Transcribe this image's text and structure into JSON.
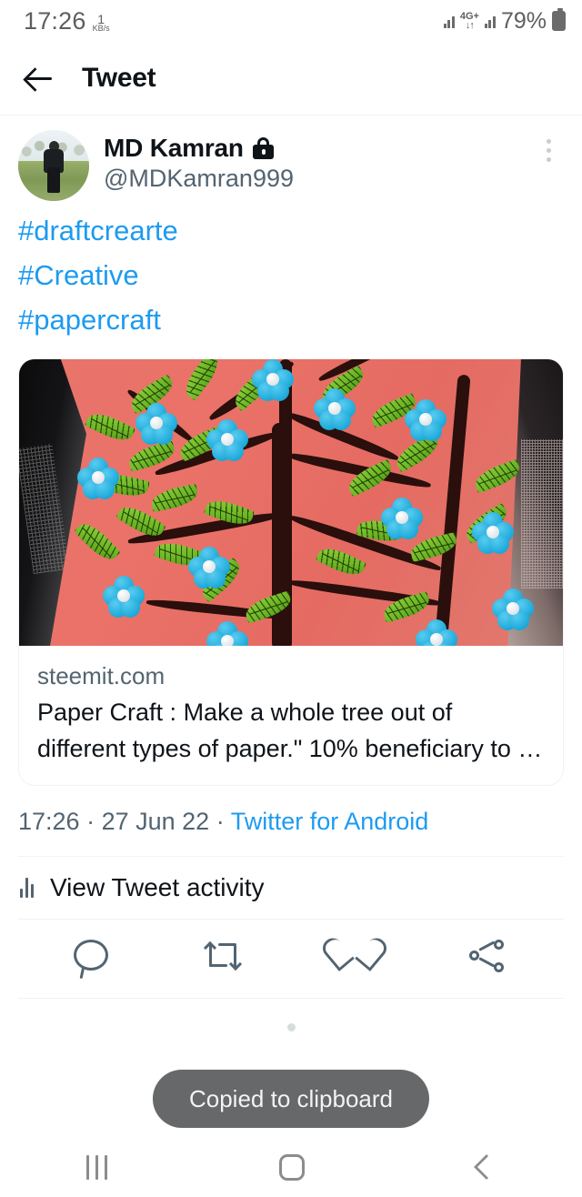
{
  "status_bar": {
    "time": "17:26",
    "network_speed_value": "1",
    "network_speed_unit": "KB/s",
    "network_type": "4G+",
    "network_arrows": "↓↑",
    "battery_percent": "79%"
  },
  "app_bar": {
    "back_icon": "arrow-left-icon",
    "title": "Tweet"
  },
  "tweet": {
    "author": {
      "display_name": "MD Kamran",
      "protected_badge_icon": "lock-icon",
      "handle": "@MDKamran999",
      "avatar_alt": "profile-photo"
    },
    "overflow_icon": "more-vertical-icon",
    "body_lines": [
      "#draftcrearte",
      "#Creative",
      "#papercraft"
    ],
    "link_card": {
      "image_alt": "papercraft-tree-photo",
      "domain": "steemit.com",
      "title": "Paper Craft : Make a whole tree out of different types of paper.\" 10% beneficiary to …"
    },
    "meta": {
      "time": "17:26",
      "separator_1": " · ",
      "date": "27 Jun 22",
      "separator_2": " · ",
      "source": "Twitter for Android"
    },
    "activity": {
      "icon": "analytics-bars-icon",
      "label": "View Tweet activity"
    },
    "actions": [
      {
        "name": "reply",
        "icon": "reply-icon",
        "count": ""
      },
      {
        "name": "retweet",
        "icon": "retweet-icon",
        "count": ""
      },
      {
        "name": "like",
        "icon": "heart-icon",
        "count": ""
      },
      {
        "name": "share",
        "icon": "share-icon",
        "count": ""
      }
    ]
  },
  "toast": {
    "message": "Copied to clipboard"
  },
  "nav_bar": {
    "recents_icon": "recents-icon",
    "home_icon": "home-icon",
    "back_icon": "back-chevron-icon"
  },
  "colors": {
    "accent_blue": "#1d9bf0",
    "text_primary": "#0f1419",
    "text_secondary": "#536471",
    "divider": "#eff3f4",
    "toast_bg": "#666869"
  }
}
